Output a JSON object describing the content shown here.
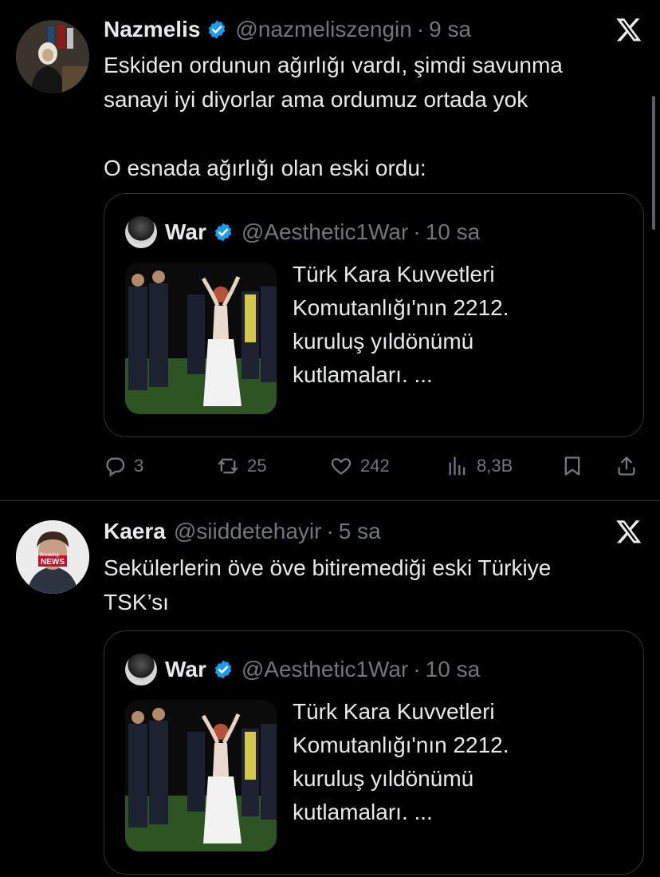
{
  "tweets": [
    {
      "author": {
        "name": "Nazmelis",
        "handle": "@nazmeliszengin",
        "verified": true
      },
      "time": "9 sa",
      "text": "Eskiden ordunun ağırlığı vardı, şimdi savunma\nsanayi iyi diyorlar ama ordumuz ortada yok\n\nO esnada ağırlığı olan eski ordu:",
      "quote": {
        "author": {
          "name": "War",
          "handle": "@Aesthetic1War",
          "verified": true
        },
        "time": "10 sa",
        "text": "Türk Kara Kuvvetleri\nKomutanlığı'nın 2212.\nkuruluş yıldönümü\nkutlamaları. ..."
      },
      "actions": {
        "replies": "3",
        "reposts": "25",
        "likes": "242",
        "views": "8,3B"
      }
    },
    {
      "author": {
        "name": "Kaera",
        "handle": "@siiddetehayir",
        "verified": false
      },
      "avatar_text": [
        "Breaking",
        "NEWS"
      ],
      "time": "5 sa",
      "text": "Sekülerlerin öve öve bitiremediği eski Türkiye\nTSK’sı",
      "quote": {
        "author": {
          "name": "War",
          "handle": "@Aesthetic1War",
          "verified": true
        },
        "time": "10 sa",
        "text": "Türk Kara Kuvvetleri\nKomutanlığı'nın 2212.\nkuruluş yıldönümü\nkutlamaları. ..."
      }
    }
  ],
  "separator": "·",
  "colors": {
    "background": "#000000",
    "text": "#e7e9ea",
    "muted": "#71767b",
    "verified": "#1d9bf0",
    "border": "#2f3336"
  },
  "icons": [
    "x-logo-icon",
    "verified-badge-icon",
    "reply-icon",
    "repost-icon",
    "like-icon",
    "views-icon",
    "bookmark-icon",
    "share-icon"
  ]
}
